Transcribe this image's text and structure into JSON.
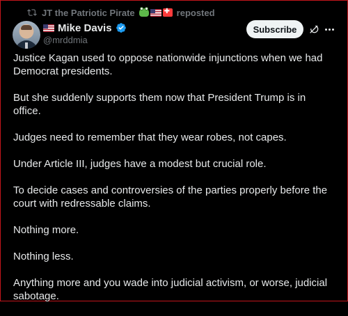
{
  "repost": {
    "reposter_name": "JT the Patriotic Pirate",
    "label": "reposted"
  },
  "author": {
    "name": "Mike Davis",
    "handle": "@mrddmia",
    "verified": true
  },
  "actions": {
    "subscribe_label": "Subscribe"
  },
  "tweet": {
    "paragraphs": [
      "Justice Kagan used to oppose nationwide injunctions when we had Democrat presidents.",
      "But she suddenly supports them now that President Trump is in office.",
      "Judges need to remember that they wear robes, not capes.",
      "Under Article III, judges have a modest but crucial role.",
      "To decide cases and controversies of the parties properly before the court with redressable claims.",
      "Nothing more.",
      "Nothing less.",
      "Anything more and you wade into judicial activism, or worse, judicial sabotage."
    ]
  },
  "colors": {
    "background": "#000000",
    "text": "#e7e9ea",
    "muted": "#71767b",
    "verified_blue": "#1d9bf0",
    "frame_border": "#c4161c"
  },
  "icons": [
    "repost-icon",
    "frog-emoji-icon",
    "us-flag-icon",
    "japan-flag-icon",
    "verified-badge-icon",
    "grok-icon",
    "more-options-icon"
  ]
}
